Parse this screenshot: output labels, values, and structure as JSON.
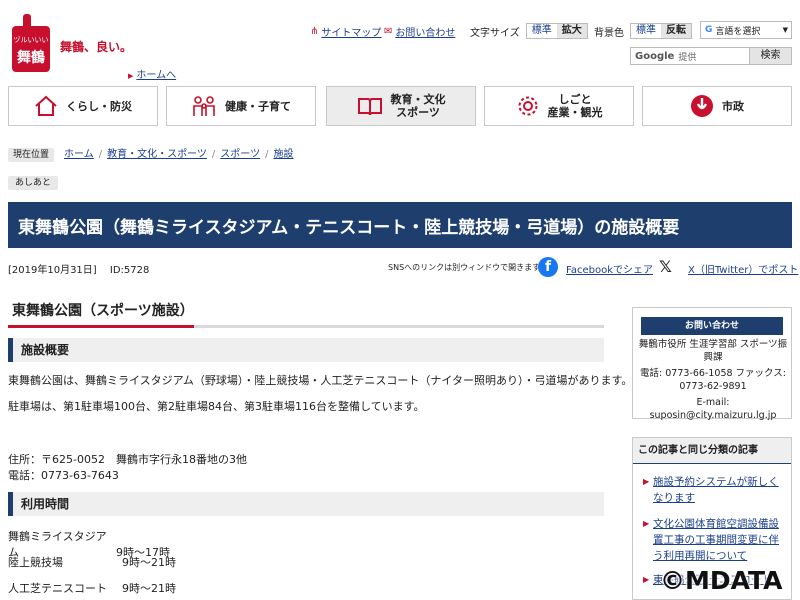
{
  "header": {
    "logo_text": "舞鶴、良い。",
    "logo_mark": "ヅルいいい 舞鶴",
    "home_link": "ホームへ",
    "sitemap": "サイトマップ",
    "contact": "お問い合わせ",
    "font_size_label": "文字サイズ",
    "font_normal": "標準",
    "font_large": "拡大",
    "bg_label": "背景色",
    "bg_normal": "標準",
    "bg_invert": "反転",
    "lang_select": "言語を選択",
    "search_brand": "Google",
    "search_hint": "提供",
    "search_button": "検索"
  },
  "nav": [
    {
      "label": "くらし・防災",
      "icon": "house-icon"
    },
    {
      "label": "健康・子育て",
      "icon": "family-icon"
    },
    {
      "label": "教育・文化\nスポーツ",
      "icon": "book-icon"
    },
    {
      "label": "しごと\n産業・観光",
      "icon": "gear-icon"
    },
    {
      "label": "市政",
      "icon": "city-emblem-icon"
    }
  ],
  "breadcrumb": {
    "label": "現在位置",
    "items": [
      "ホーム",
      "教育・文化・スポーツ",
      "スポーツ",
      "施設"
    ]
  },
  "ashiato": "あしあと",
  "page_title": "東舞鶴公園（舞鶴ミライスタジアム・テニスコート・陸上競技場・弓道場）の施設概要",
  "meta": {
    "date": "[2019年10月31日]",
    "id": "ID:5728"
  },
  "sns": {
    "note": "SNSへのリンクは別ウィンドウで開きます",
    "facebook": "Facebookでシェア",
    "x": "X（旧Twitter）でポスト"
  },
  "content": {
    "heading": "東舞鶴公園（スポーツ施設）",
    "section1": "施設概要",
    "para1": "東舞鶴公園は、舞鶴ミライスタジアム（野球場）・陸上競技場・人工芝テニスコート（ナイター照明あり）・弓道場があります。",
    "para2": "駐車場は、第1駐車場100台、第2駐車場84台、第3駐車場116台を整備しています。",
    "address": "住所：〒625-0052　舞鶴市字行永18番地の3他",
    "phone": "電話：0773-63-7643",
    "section2": "利用時間",
    "hours": [
      {
        "name": "舞鶴ミライスタジアム",
        "time": "9時～17時"
      },
      {
        "name": "陸上競技場",
        "time": "9時～21時"
      },
      {
        "name": "人工芝テニスコート",
        "time": "9時～21時"
      }
    ]
  },
  "sidebar": {
    "contact_head": "お問い合わせ",
    "contact_lines": [
      "舞鶴市役所 生涯学習部 スポーツ振興課",
      "電話: 0773-66-1058 ファックス: 0773-62-9891",
      "E-mail: suposin@city.maizuru.lg.jp"
    ],
    "related_head": "この記事と同じ分類の記事",
    "related": [
      "施設予約システムが新しくなります",
      "文化公園体育館空調設備設置工事の工事期間変更に伴う利用再開について",
      "東舞鶴公園 テニスコート"
    ]
  },
  "watermark": "©MDATA"
}
